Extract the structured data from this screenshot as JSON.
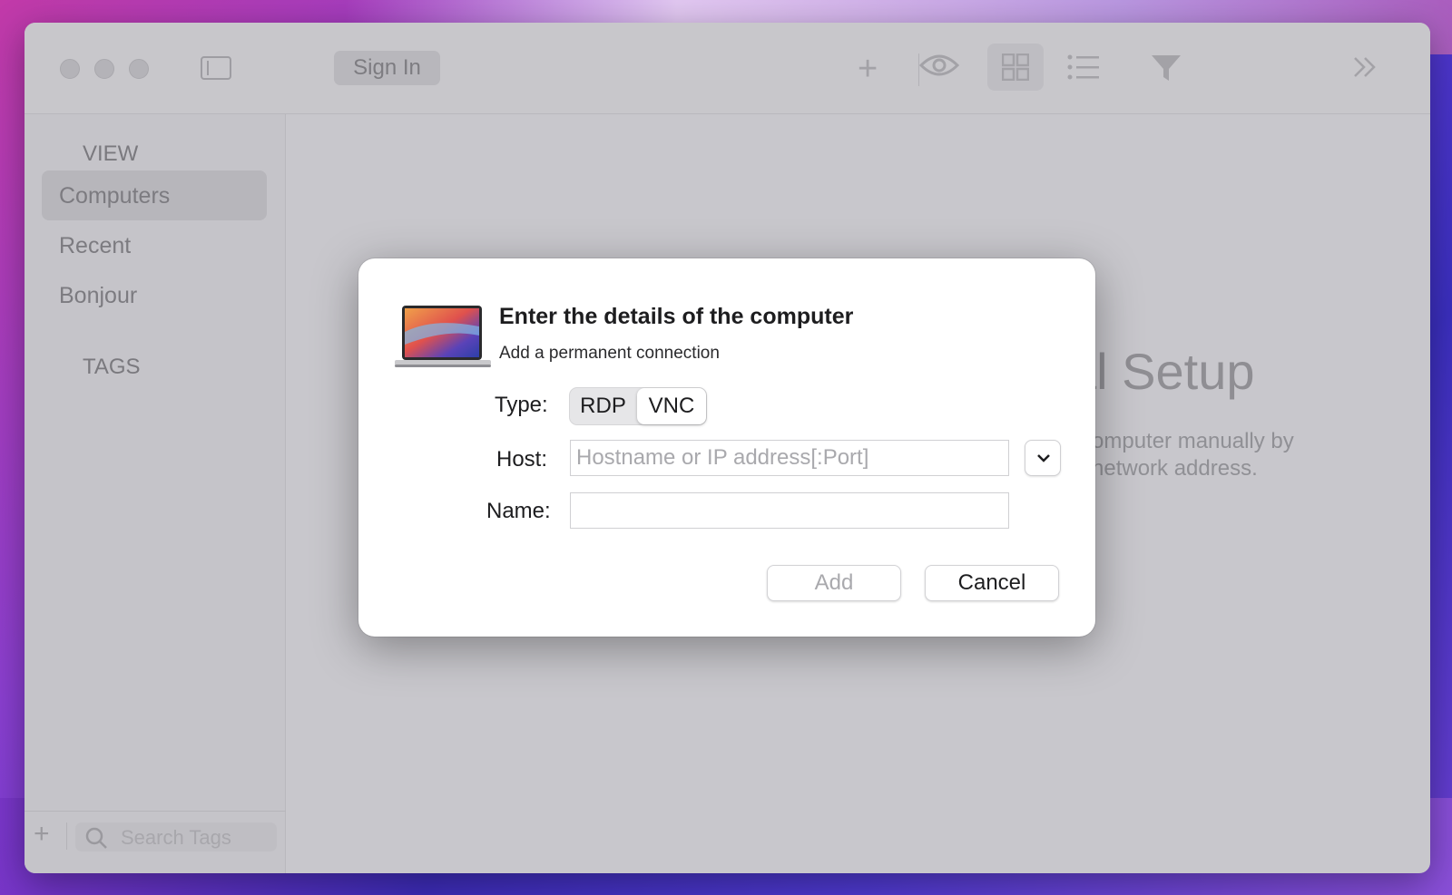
{
  "toolbar": {
    "sign_in_label": "Sign In",
    "icons": [
      "sidebar-toggle-icon",
      "plus-icon",
      "eye-icon",
      "grid-icon",
      "list-icon",
      "filter-icon",
      "chevron-double-right-icon"
    ]
  },
  "sidebar": {
    "view_heading": "VIEW",
    "items": [
      {
        "label": "Computers",
        "selected": true
      },
      {
        "label": "Recent",
        "selected": false
      },
      {
        "label": "Bonjour",
        "selected": false
      }
    ],
    "tags_heading": "TAGS",
    "search_placeholder": "Search Tags"
  },
  "main": {
    "title_fragment": "al Setup",
    "description_fragment": "omputer manually by network address."
  },
  "dialog": {
    "title": "Enter the details of the computer",
    "subtitle": "Add a permanent connection",
    "type_label": "Type:",
    "type_options": [
      "RDP",
      "VNC"
    ],
    "type_selected": "VNC",
    "host_label": "Host:",
    "host_placeholder": "Hostname or IP address[:Port]",
    "host_value": "",
    "name_label": "Name:",
    "name_value": "",
    "add_label": "Add",
    "cancel_label": "Cancel"
  },
  "colors": {
    "window_bg": "#c8c7cc",
    "dialog_bg": "#ffffff",
    "disabled_text": "#a9a9ad"
  }
}
